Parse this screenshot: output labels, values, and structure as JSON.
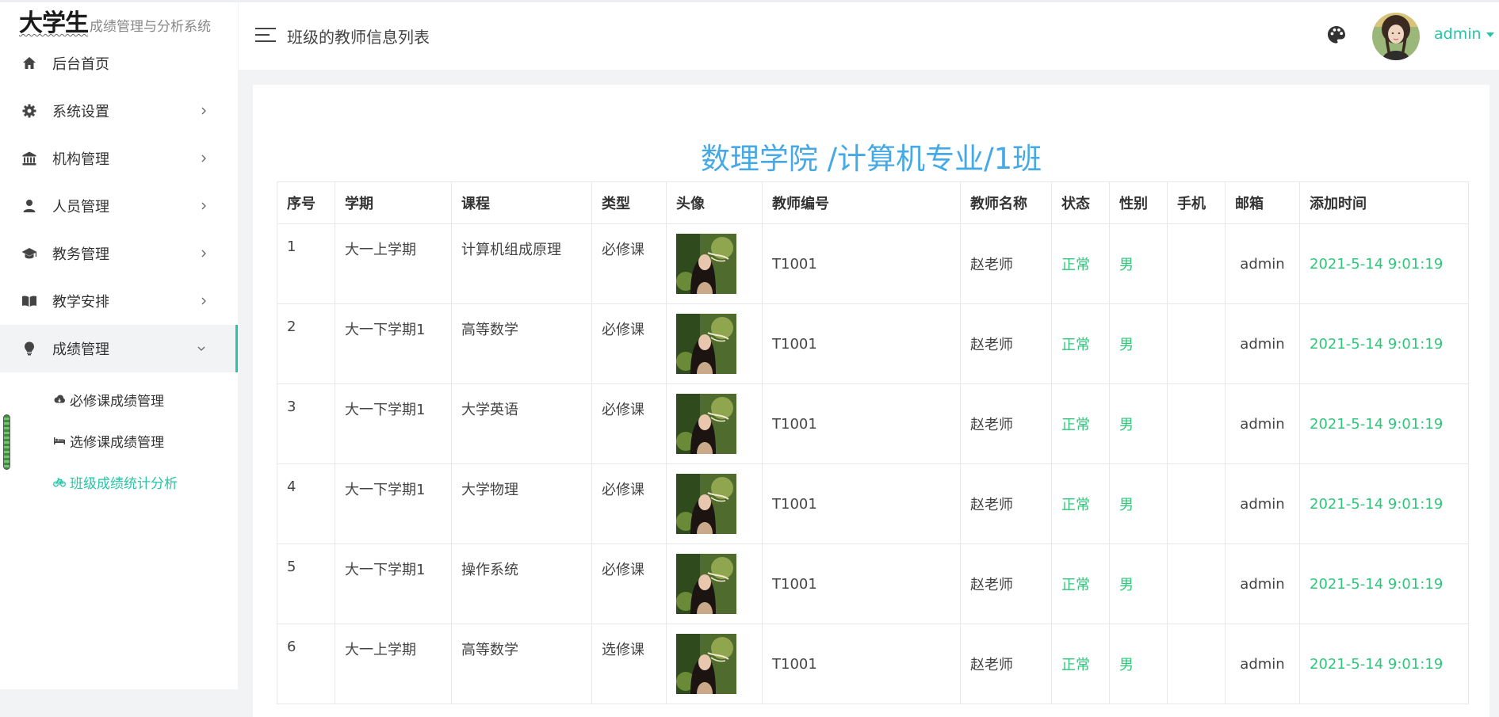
{
  "brand": {
    "title": "大学生",
    "subtitle": "成绩管理与分析系统"
  },
  "menu": [
    {
      "label": "后台首页",
      "icon": "home-icon",
      "has_arrow": false
    },
    {
      "label": "系统设置",
      "icon": "gear-icon",
      "has_arrow": true
    },
    {
      "label": "机构管理",
      "icon": "bank-icon",
      "has_arrow": true
    },
    {
      "label": "人员管理",
      "icon": "user-icon",
      "has_arrow": true
    },
    {
      "label": "教务管理",
      "icon": "graduation-cap-icon",
      "has_arrow": true
    },
    {
      "label": "教学安排",
      "icon": "book-icon",
      "has_arrow": true
    },
    {
      "label": "成绩管理",
      "icon": "lightbulb-icon",
      "has_arrow": true,
      "expanded": true
    }
  ],
  "submenu": [
    {
      "label": "必修课成绩管理",
      "icon": "cloud-icon"
    },
    {
      "label": "选修课成绩管理",
      "icon": "bed-icon"
    },
    {
      "label": "班级成绩统计分析",
      "icon": "bicycle-icon",
      "current": true
    }
  ],
  "header": {
    "title": "班级的教师信息列表",
    "user": "admin"
  },
  "table": {
    "caption": "数理学院 /计算机专业/1班",
    "columns": [
      "序号",
      "学期",
      "课程",
      "类型",
      "头像",
      "教师编号",
      "教师名称",
      "状态",
      "性别",
      "手机",
      "邮箱",
      "添加时间"
    ],
    "rows": [
      {
        "no": "1",
        "term": "大一上学期",
        "course": "计算机组成原理",
        "type": "必修课",
        "teacher_id": "T1001",
        "teacher_name": "赵老师",
        "status": "正常",
        "gender": "男",
        "phone": "",
        "email": "admin",
        "added": "2021-5-14 9:01:19"
      },
      {
        "no": "2",
        "term": "大一下学期1",
        "course": "高等数学",
        "type": "必修课",
        "teacher_id": "T1001",
        "teacher_name": "赵老师",
        "status": "正常",
        "gender": "男",
        "phone": "",
        "email": "admin",
        "added": "2021-5-14 9:01:19"
      },
      {
        "no": "3",
        "term": "大一下学期1",
        "course": "大学英语",
        "type": "必修课",
        "teacher_id": "T1001",
        "teacher_name": "赵老师",
        "status": "正常",
        "gender": "男",
        "phone": "",
        "email": "admin",
        "added": "2021-5-14 9:01:19"
      },
      {
        "no": "4",
        "term": "大一下学期1",
        "course": "大学物理",
        "type": "必修课",
        "teacher_id": "T1001",
        "teacher_name": "赵老师",
        "status": "正常",
        "gender": "男",
        "phone": "",
        "email": "admin",
        "added": "2021-5-14 9:01:19"
      },
      {
        "no": "5",
        "term": "大一下学期1",
        "course": "操作系统",
        "type": "必修课",
        "teacher_id": "T1001",
        "teacher_name": "赵老师",
        "status": "正常",
        "gender": "男",
        "phone": "",
        "email": "admin",
        "added": "2021-5-14 9:01:19"
      },
      {
        "no": "6",
        "term": "大一上学期",
        "course": "高等数学",
        "type": "选修课",
        "teacher_id": "T1001",
        "teacher_name": "赵老师",
        "status": "正常",
        "gender": "男",
        "phone": "",
        "email": "admin",
        "added": "2021-5-14 9:01:19"
      }
    ]
  },
  "colors": {
    "accent": "#26c6a6",
    "caption": "#45a9e6",
    "status_green": "#2ec77a"
  }
}
